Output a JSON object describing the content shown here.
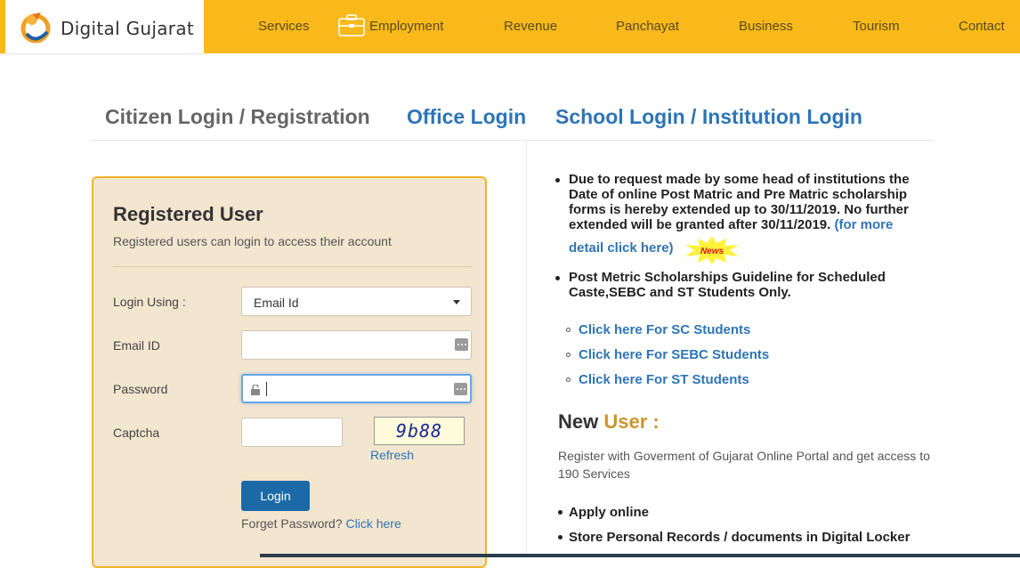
{
  "header": {
    "logo_text": "Digital Gujarat",
    "nav": [
      "Services",
      "Employment",
      "Revenue",
      "Panchayat",
      "Business",
      "Tourism",
      "Contact"
    ],
    "brand_color": "#f9b91a"
  },
  "tabs": {
    "citizen": "Citizen Login / Registration",
    "office": "Office Login",
    "school": "School Login / Institution Login"
  },
  "login": {
    "title": "Registered User",
    "subtitle": "Registered users can login to access their account",
    "login_using_label": "Login Using :",
    "login_using_value": "Email Id",
    "email_label": "Email ID",
    "email_value": "",
    "password_label": "Password",
    "password_value": "",
    "captcha_label": "Captcha",
    "captcha_value": "",
    "captcha_code": "9b88",
    "refresh": "Refresh",
    "button": "Login",
    "forget_text": "Forget Password?",
    "forget_link": "Click here"
  },
  "news": {
    "item1_line1": "Due to request made by some head of institutions the",
    "item1_line2": "Date of online Post Matric and Pre Matric scholarship",
    "item1_line3": "forms is hereby extended up to 30/11/2019. No further",
    "item1_line4": "extended will be granted after 30/11/2019.",
    "item1_link_a": "(for more",
    "item1_link_b": "detail click here)",
    "badge": "News",
    "item2_line1": "Post Metric Scholarships Guideline for Scheduled",
    "item2_line2": "Caste,SEBC and ST Students Only.",
    "links": [
      "Click here For SC Students",
      "Click here For SEBC Students",
      "Click here For ST Students"
    ]
  },
  "new_user": {
    "title_a": "New",
    "title_b": "User :",
    "desc": "Register with Goverment of Gujarat Online Portal and get access to 190 Services",
    "features": [
      "Apply online",
      "Store Personal Records / documents in Digital Locker"
    ]
  }
}
